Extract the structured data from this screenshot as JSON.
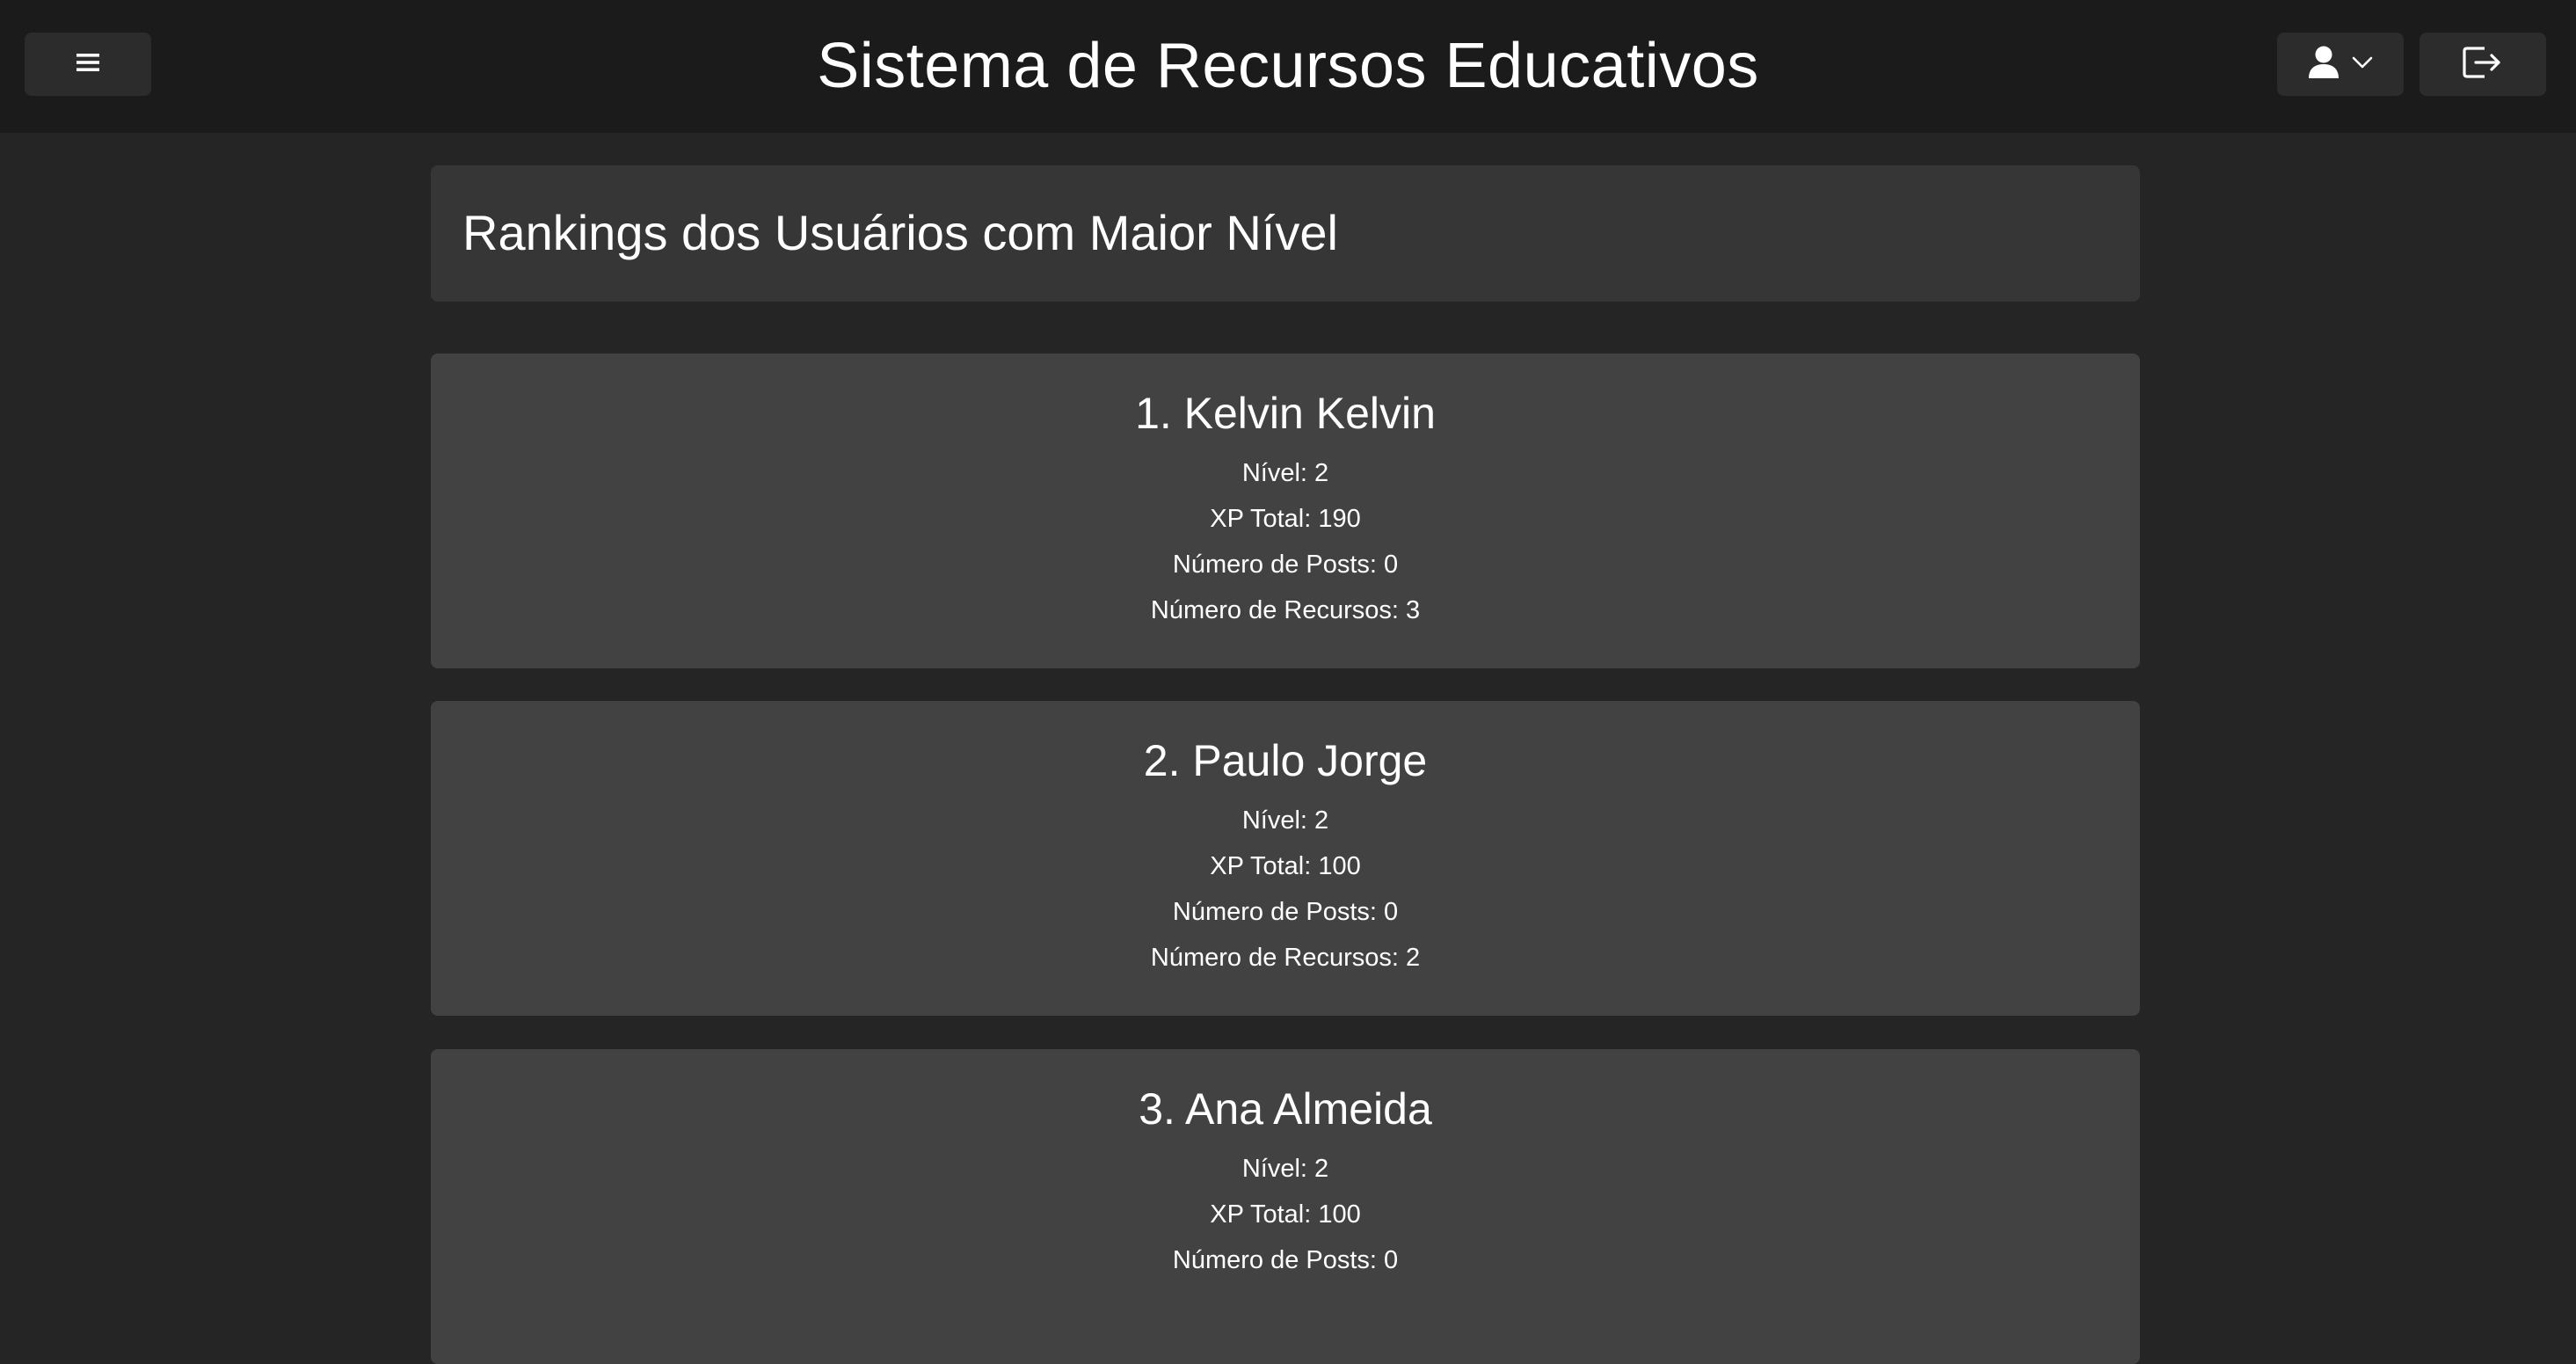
{
  "header": {
    "title": "Sistema de Recursos Educativos",
    "menu_icon": "hamburger-icon",
    "user_icon": "user-icon",
    "dropdown_icon": "chevron-down-icon",
    "logout_icon": "logout-icon"
  },
  "page": {
    "heading": "Rankings dos Usuários com Maior Nível"
  },
  "labels": {
    "level": "Nível:",
    "xp_total": "XP Total:",
    "posts": "Número de Posts:",
    "resources": "Número de Recursos:"
  },
  "rankings": [
    {
      "title": "1. Kelvin Kelvin",
      "level": "2",
      "xp_total": "190",
      "posts": "0",
      "resources": "3"
    },
    {
      "title": "2. Paulo Jorge",
      "level": "2",
      "xp_total": "100",
      "posts": "0",
      "resources": "2"
    },
    {
      "title": "3. Ana Almeida",
      "level": "2",
      "xp_total": "100",
      "posts": "0"
    }
  ],
  "colors": {
    "background": "#252525",
    "header": "#1b1b1b",
    "heading_panel": "#363636",
    "card": "#424242",
    "button": "#2c2c2c",
    "text": "#ffffff"
  }
}
